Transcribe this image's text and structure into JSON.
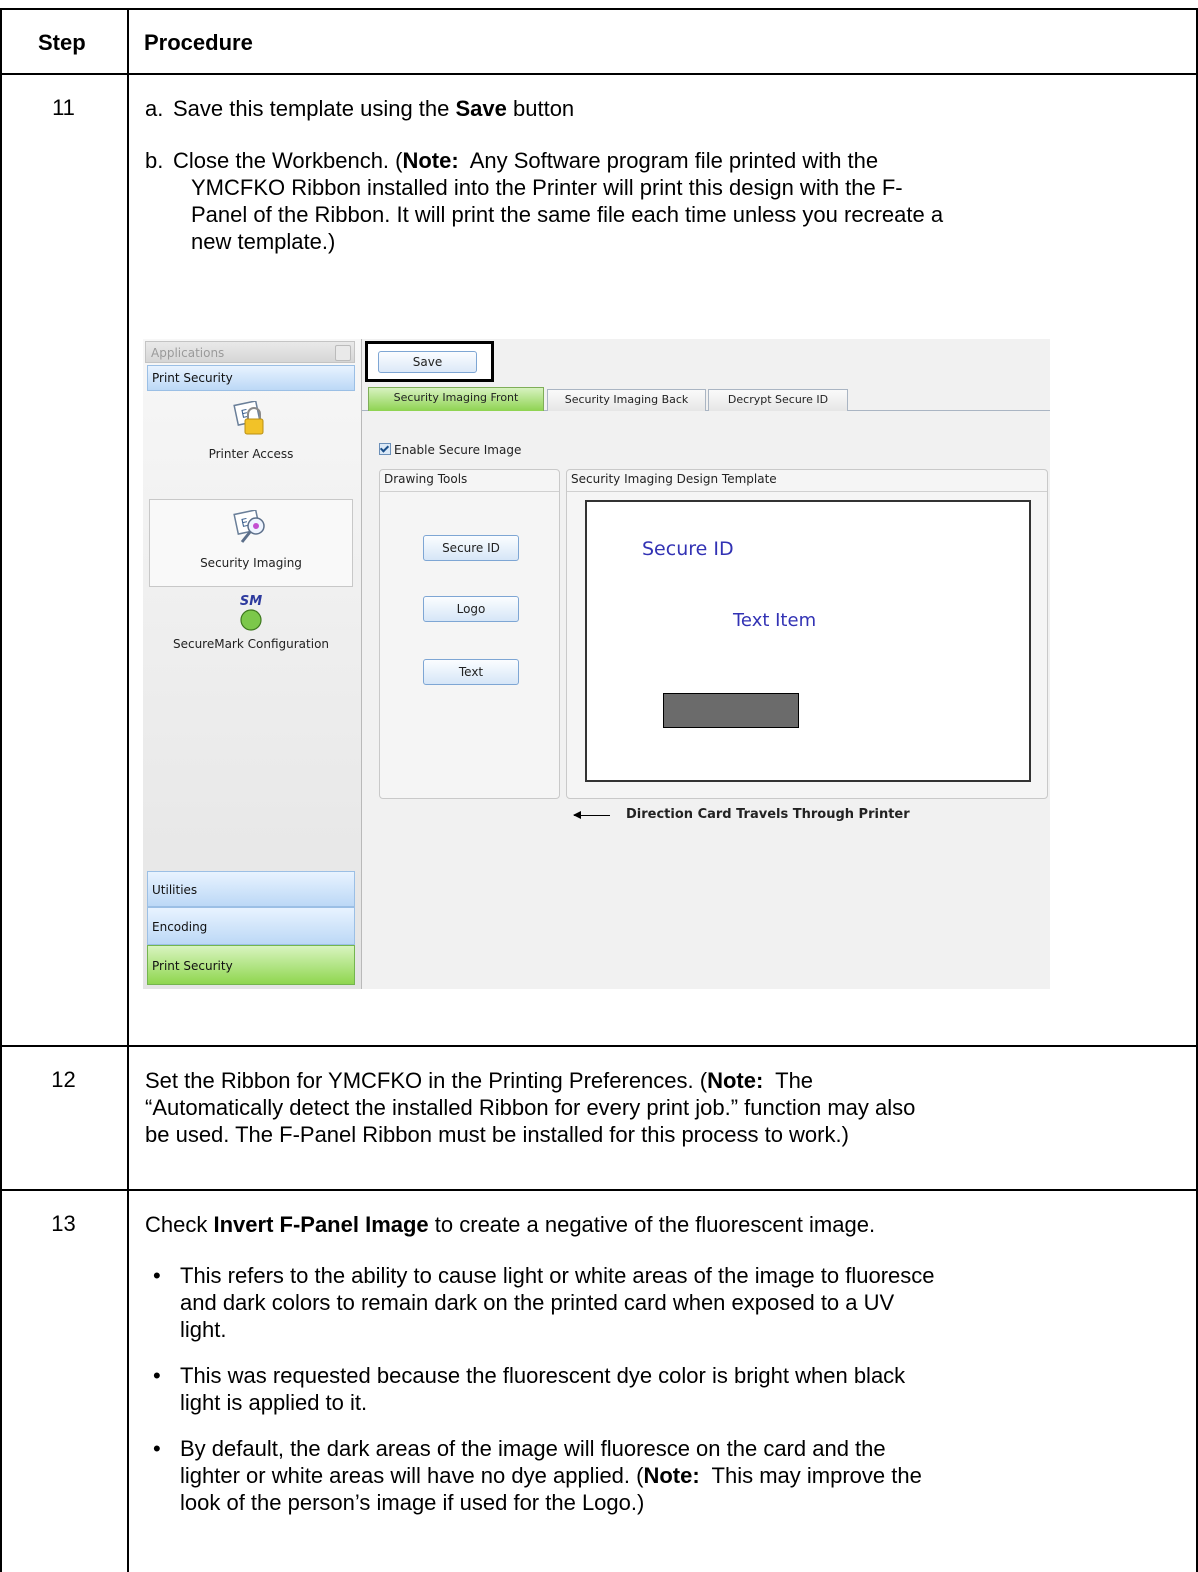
{
  "table": {
    "header_step": "Step",
    "header_procedure": "Procedure"
  },
  "step11": {
    "number": "11",
    "a_label": "a.",
    "a_text_1": "Save this template using the ",
    "a_bold": "Save",
    "a_text_2": " button",
    "b_label": "b.",
    "b_line1_pre": "Close the Workbench. (",
    "b_note": "Note:",
    "b_line1_post": "  Any Software program file printed with the",
    "b_line2": "YMCFKO Ribbon installed into the Printer will print this design with the F-",
    "b_line3": "Panel of the Ribbon. It will print the same file each time unless you recreate a",
    "b_line4": "new template.)"
  },
  "screenshot": {
    "sidebar_title": "Applications",
    "category_top": "Print Security",
    "items": [
      {
        "label": "Printer Access",
        "icon": "printer-access-lock-icon"
      },
      {
        "label": "Security Imaging",
        "icon": "security-imaging-icon"
      },
      {
        "label": "SecureMark Configuration",
        "icon": "securemark-icon",
        "badge": "SM"
      }
    ],
    "categories_bottom": [
      "Utilities",
      "Encoding",
      "Print Security"
    ],
    "save_button": "Save",
    "tabs": [
      "Security Imaging Front",
      "Security Imaging Back",
      "Decrypt Secure ID"
    ],
    "enable_checkbox": "Enable Secure Image",
    "drawing_tools_title": "Drawing Tools",
    "tools": [
      "Secure ID",
      "Logo",
      "Text"
    ],
    "template_title": "Security Imaging Design Template",
    "canvas_secure_id": "Secure ID",
    "canvas_text_item": "Text Item",
    "direction_label": "Direction Card Travels Through Printer"
  },
  "step12": {
    "number": "12",
    "line1_pre": "Set the Ribbon for YMCFKO in the Printing Preferences. (",
    "line1_note": "Note:",
    "line1_post": "  The",
    "line2": "“Automatically detect the installed Ribbon for every print job.” function may also",
    "line3": "be used. The F-Panel Ribbon must be installed for this process to work.)"
  },
  "step13": {
    "number": "13",
    "intro_pre": "Check ",
    "intro_bold": "Invert F-Panel Image",
    "intro_post": " to create a negative of the fluorescent image.",
    "bullet1_l1": "This refers to the ability to cause light or white areas of the image to fluoresce",
    "bullet1_l2": "and dark colors to remain dark on the printed card when exposed to a UV",
    "bullet1_l3": "light.",
    "bullet2_l1": "This was requested because the fluorescent dye color is bright when black",
    "bullet2_l2": "light is applied to it.",
    "bullet3_l1": "By default, the dark areas of the image will fluoresce on the card and the",
    "bullet3_l2_pre": "lighter or white areas will have no dye applied. (",
    "bullet3_l2_note": "Note:",
    "bullet3_l2_post": "  This may improve the",
    "bullet3_l3": "look of the person’s image if used for the Logo.)"
  }
}
